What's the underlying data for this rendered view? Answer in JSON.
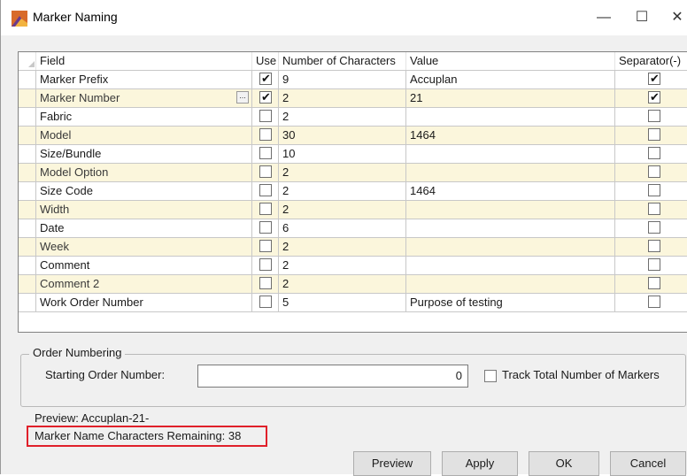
{
  "window": {
    "title": "Marker Naming",
    "minimize_glyph": "—",
    "maximize_glyph": "☐",
    "close_glyph": "✕"
  },
  "table": {
    "columns": [
      "Field",
      "Use",
      "Number of Characters",
      "Value",
      "Separator(-)"
    ],
    "rows": [
      {
        "field": "Marker Prefix",
        "use": true,
        "chars": "9",
        "value": "Accuplan",
        "separator": true,
        "alt": false,
        "ellipsis": false
      },
      {
        "field": "Marker Number",
        "use": true,
        "chars": "2",
        "value": "21",
        "separator": true,
        "alt": true,
        "ellipsis": true
      },
      {
        "field": "Fabric",
        "use": false,
        "chars": "2",
        "value": "",
        "separator": false,
        "alt": false,
        "ellipsis": false
      },
      {
        "field": "Model",
        "use": false,
        "chars": "30",
        "value": "1464",
        "separator": false,
        "alt": true,
        "ellipsis": false
      },
      {
        "field": "Size/Bundle",
        "use": false,
        "chars": "10",
        "value": "",
        "separator": false,
        "alt": false,
        "ellipsis": false
      },
      {
        "field": "Model Option",
        "use": false,
        "chars": "2",
        "value": "",
        "separator": false,
        "alt": true,
        "ellipsis": false
      },
      {
        "field": "Size Code",
        "use": false,
        "chars": "2",
        "value": "1464",
        "separator": false,
        "alt": false,
        "ellipsis": false
      },
      {
        "field": "Width",
        "use": false,
        "chars": "2",
        "value": "",
        "separator": false,
        "alt": true,
        "ellipsis": false
      },
      {
        "field": "Date",
        "use": false,
        "chars": "6",
        "value": "",
        "separator": false,
        "alt": false,
        "ellipsis": false
      },
      {
        "field": "Week",
        "use": false,
        "chars": "2",
        "value": "",
        "separator": false,
        "alt": true,
        "ellipsis": false
      },
      {
        "field": "Comment",
        "use": false,
        "chars": "2",
        "value": "",
        "separator": false,
        "alt": false,
        "ellipsis": false
      },
      {
        "field": "Comment 2",
        "use": false,
        "chars": "2",
        "value": "",
        "separator": false,
        "alt": true,
        "ellipsis": false
      },
      {
        "field": "Work Order Number",
        "use": false,
        "chars": "5",
        "value": "Purpose of testing",
        "separator": false,
        "alt": false,
        "ellipsis": false
      }
    ],
    "ellipsis_label": "..."
  },
  "order_numbering": {
    "group_title": "Order Numbering",
    "starting_label": "Starting Order Number:",
    "starting_value": "0",
    "track_label": "Track Total Number of Markers",
    "track_checked": false
  },
  "preview_text": "Preview:  Accuplan-21-",
  "remaining_text": "Marker Name Characters Remaining: 38",
  "buttons": {
    "preview": "Preview",
    "apply": "Apply",
    "ok": "OK",
    "cancel": "Cancel"
  },
  "colors": {
    "alt_row": "#fbf6dc",
    "highlight_border": "#e0202a"
  }
}
